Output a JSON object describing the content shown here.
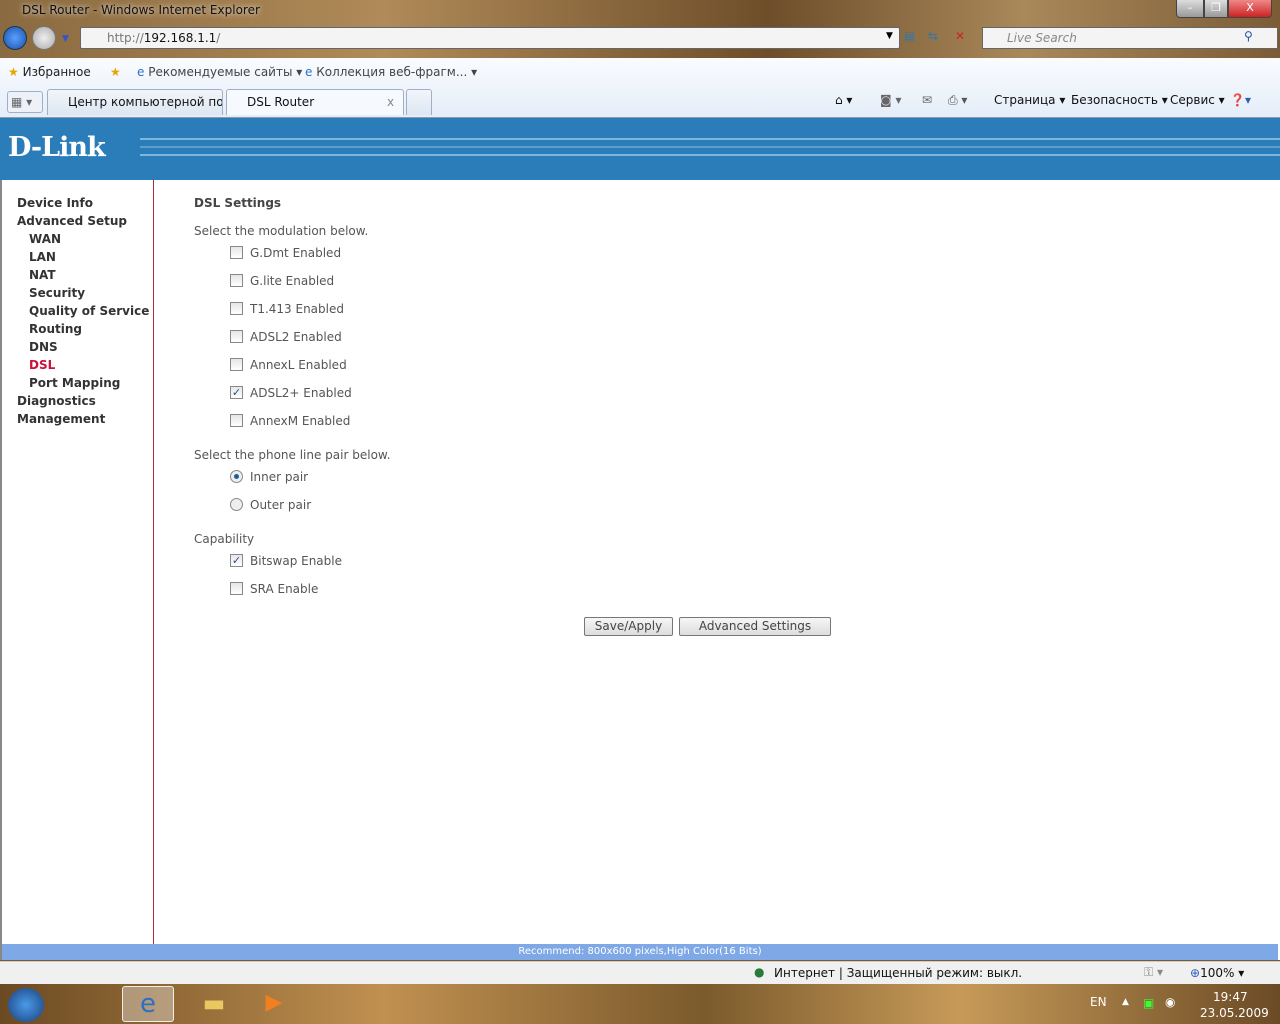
{
  "window": {
    "title": "DSL Router - Windows Internet Explorer",
    "min": "–",
    "max": "❐",
    "close": "X"
  },
  "address": {
    "prefix": "http://",
    "host": "192.168.1.1",
    "suffix": "/"
  },
  "search": {
    "placeholder": "Live Search"
  },
  "favorites": {
    "label": "Избранное",
    "items": [
      "Рекомендуемые сайты ▾",
      "Коллекция веб-фрагм... ▾"
    ]
  },
  "tabs": [
    {
      "label": "Центр компьютерной по..."
    },
    {
      "label": "DSL Router",
      "close": "x"
    }
  ],
  "commands": [
    "Страница ▾",
    "Безопасность ▾",
    "Сервис ▾"
  ],
  "brand": {
    "logo": "D-Link"
  },
  "sidebar": {
    "items": [
      {
        "label": "Device Info",
        "level": 0
      },
      {
        "label": "Advanced Setup",
        "level": 0
      },
      {
        "label": "WAN",
        "level": 1
      },
      {
        "label": "LAN",
        "level": 1
      },
      {
        "label": "NAT",
        "level": 1
      },
      {
        "label": "Security",
        "level": 1
      },
      {
        "label": "Quality of Service",
        "level": 1
      },
      {
        "label": "Routing",
        "level": 1
      },
      {
        "label": "DNS",
        "level": 1
      },
      {
        "label": "DSL",
        "level": 1,
        "selected": true
      },
      {
        "label": "Port Mapping",
        "level": 1
      },
      {
        "label": "Diagnostics",
        "level": 0
      },
      {
        "label": "Management",
        "level": 0
      }
    ]
  },
  "main": {
    "title": "DSL Settings",
    "modulation_label": "Select the modulation below.",
    "modulations": [
      {
        "label": "G.Dmt Enabled",
        "checked": false
      },
      {
        "label": "G.lite Enabled",
        "checked": false
      },
      {
        "label": "T1.413 Enabled",
        "checked": false
      },
      {
        "label": "ADSL2 Enabled",
        "checked": false
      },
      {
        "label": "AnnexL Enabled",
        "checked": false
      },
      {
        "label": "ADSL2+ Enabled",
        "checked": true
      },
      {
        "label": "AnnexM Enabled",
        "checked": false
      }
    ],
    "pair_label": "Select the phone line pair below.",
    "pairs": [
      {
        "label": "Inner pair",
        "selected": true
      },
      {
        "label": "Outer pair",
        "selected": false
      }
    ],
    "capability_label": "Capability",
    "capabilities": [
      {
        "label": "Bitswap Enable",
        "checked": true
      },
      {
        "label": "SRA Enable",
        "checked": false
      }
    ],
    "save_label": "Save/Apply",
    "advanced_label": "Advanced Settings"
  },
  "footer": {
    "text": "Recommend: 800x600 pixels,High Color(16 Bits)"
  },
  "status": {
    "zone": "Интернет | Защищенный режим: выкл.",
    "zoom": "100%"
  },
  "taskbar": {
    "lang": "EN",
    "time": "19:47",
    "date": "23.05.2009"
  },
  "colors": {
    "header": "#2a7db9",
    "selected_nav": "#d0103a",
    "footer": "#7fa8e6"
  }
}
